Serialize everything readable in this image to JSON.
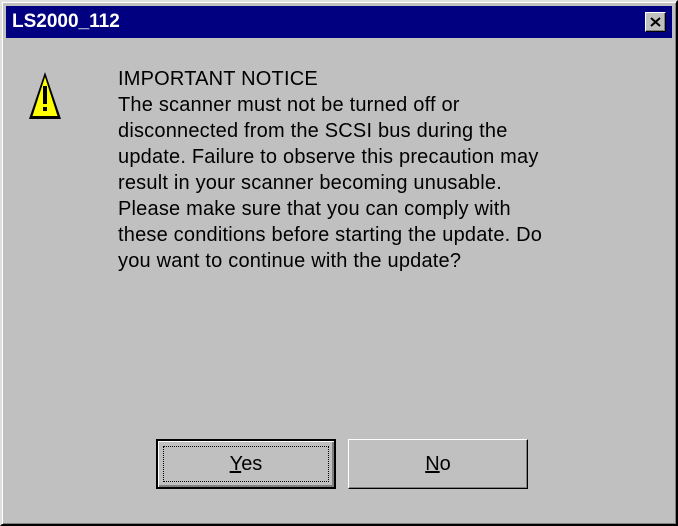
{
  "window": {
    "title": "LS2000_112"
  },
  "icon": {
    "name": "warning-icon",
    "color": "#ffff00"
  },
  "message": {
    "heading": "IMPORTANT NOTICE",
    "lines": [
      "The scanner must not be turned off or",
      "disconnected from the SCSI bus during the",
      "update. Failure to observe this precaution may",
      "result in your scanner becoming unusable.",
      "Please make sure that you can comply with",
      "these conditions before starting the update. Do",
      "you want to continue with the update?"
    ]
  },
  "buttons": {
    "yes": {
      "mnemonic": "Y",
      "rest": "es"
    },
    "no": {
      "mnemonic": "N",
      "rest": "o"
    }
  },
  "colors": {
    "face": "#c0c0c0",
    "titlebar": "#000080"
  }
}
